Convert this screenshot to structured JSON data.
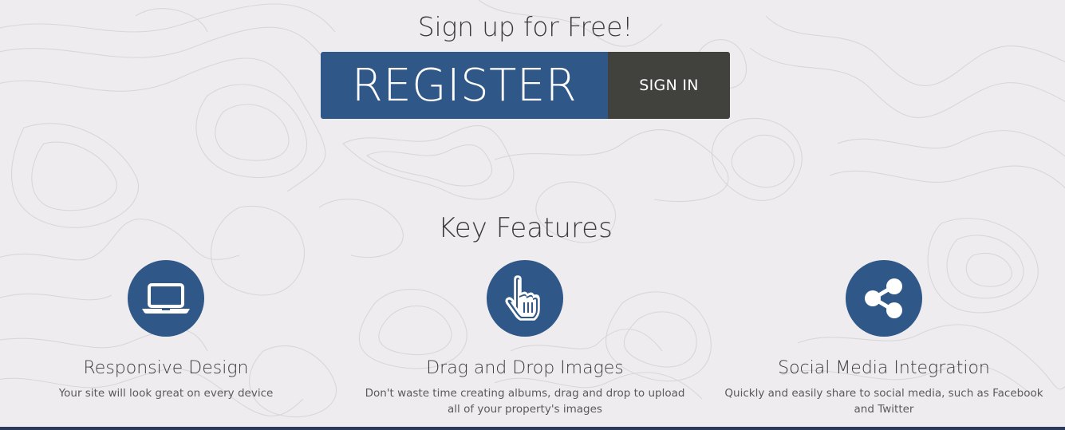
{
  "signup": {
    "title": "Sign up for Free!",
    "register_label": "REGISTER",
    "signin_label": "SIGN IN"
  },
  "features": {
    "title": "Key Features",
    "items": [
      {
        "icon": "laptop-icon",
        "title": "Responsive Design",
        "description": "Your site will look great on every device"
      },
      {
        "icon": "pointer-hand-icon",
        "title": "Drag and Drop Images",
        "description": "Don't waste time creating albums, drag and drop to upload all of your property's images"
      },
      {
        "icon": "share-icon",
        "title": "Social Media Integration",
        "description": "Quickly and easily share to social media, such as Facebook and Twitter"
      }
    ]
  },
  "colors": {
    "primary": "#2f5888",
    "secondary": "#41413d",
    "background": "#efecf0"
  }
}
